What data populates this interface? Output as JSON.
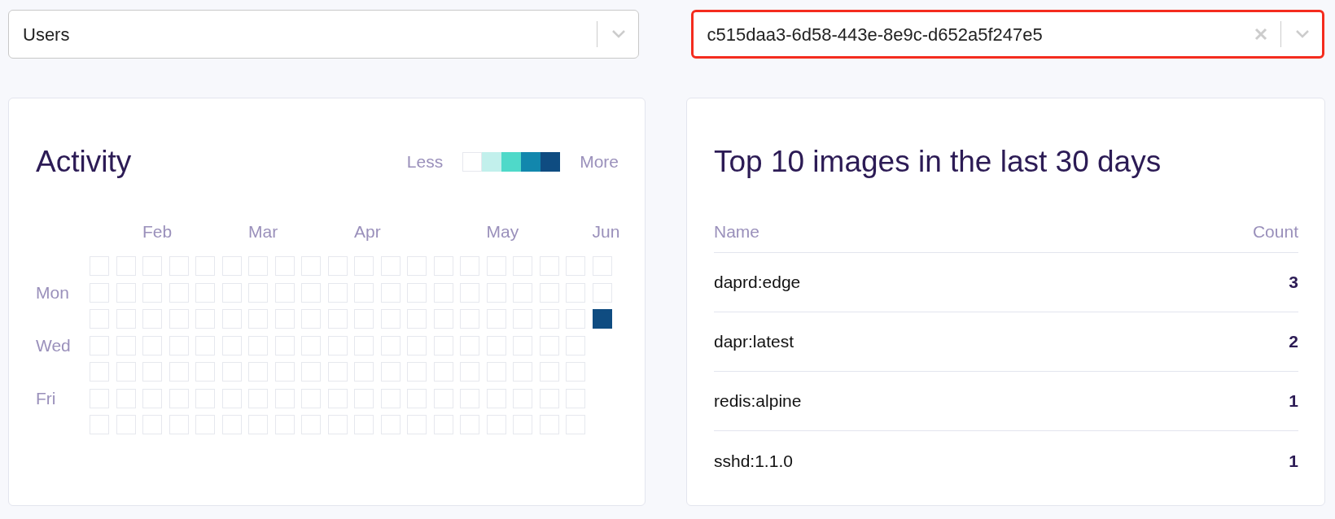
{
  "selects": [
    {
      "value": "Users",
      "clearable": false,
      "focused": false
    },
    {
      "value": "c515daa3-6d58-443e-8e9c-d652a5f247e5",
      "clearable": true,
      "focused": true
    }
  ],
  "activity": {
    "title": "Activity",
    "legend": {
      "less": "Less",
      "more": "More",
      "swatches": [
        {
          "color": "#ffffff"
        },
        {
          "color": "#c2f0ec"
        },
        {
          "color": "#4fd9c9"
        },
        {
          "color": "#1287ad"
        },
        {
          "color": "#0f4c81"
        }
      ]
    },
    "day_labels": [
      "Mon",
      "Wed",
      "Fri"
    ],
    "weeks": [
      {
        "days": [
          {
            "color": "#ffffff"
          },
          {
            "color": "#ffffff"
          },
          {
            "color": "#ffffff"
          },
          {
            "color": "#ffffff"
          },
          {
            "color": "#ffffff"
          },
          {
            "color": "#ffffff"
          },
          {
            "color": "#ffffff"
          }
        ]
      },
      {
        "days": [
          {
            "color": "#ffffff"
          },
          {
            "color": "#ffffff"
          },
          {
            "color": "#ffffff"
          },
          {
            "color": "#ffffff"
          },
          {
            "color": "#ffffff"
          },
          {
            "color": "#ffffff"
          },
          {
            "color": "#ffffff"
          }
        ]
      },
      {
        "month": "Feb",
        "days": [
          {
            "color": "#ffffff"
          },
          {
            "color": "#ffffff"
          },
          {
            "color": "#ffffff"
          },
          {
            "color": "#ffffff"
          },
          {
            "color": "#ffffff"
          },
          {
            "color": "#ffffff"
          },
          {
            "color": "#ffffff"
          }
        ]
      },
      {
        "days": [
          {
            "color": "#ffffff"
          },
          {
            "color": "#ffffff"
          },
          {
            "color": "#ffffff"
          },
          {
            "color": "#ffffff"
          },
          {
            "color": "#ffffff"
          },
          {
            "color": "#ffffff"
          },
          {
            "color": "#ffffff"
          }
        ]
      },
      {
        "days": [
          {
            "color": "#ffffff"
          },
          {
            "color": "#ffffff"
          },
          {
            "color": "#ffffff"
          },
          {
            "color": "#ffffff"
          },
          {
            "color": "#ffffff"
          },
          {
            "color": "#ffffff"
          },
          {
            "color": "#ffffff"
          }
        ]
      },
      {
        "days": [
          {
            "color": "#ffffff"
          },
          {
            "color": "#ffffff"
          },
          {
            "color": "#ffffff"
          },
          {
            "color": "#ffffff"
          },
          {
            "color": "#ffffff"
          },
          {
            "color": "#ffffff"
          },
          {
            "color": "#ffffff"
          }
        ]
      },
      {
        "month": "Mar",
        "days": [
          {
            "color": "#ffffff"
          },
          {
            "color": "#ffffff"
          },
          {
            "color": "#ffffff"
          },
          {
            "color": "#ffffff"
          },
          {
            "color": "#ffffff"
          },
          {
            "color": "#ffffff"
          },
          {
            "color": "#ffffff"
          }
        ]
      },
      {
        "days": [
          {
            "color": "#ffffff"
          },
          {
            "color": "#ffffff"
          },
          {
            "color": "#ffffff"
          },
          {
            "color": "#ffffff"
          },
          {
            "color": "#ffffff"
          },
          {
            "color": "#ffffff"
          },
          {
            "color": "#ffffff"
          }
        ]
      },
      {
        "days": [
          {
            "color": "#ffffff"
          },
          {
            "color": "#ffffff"
          },
          {
            "color": "#ffffff"
          },
          {
            "color": "#ffffff"
          },
          {
            "color": "#ffffff"
          },
          {
            "color": "#ffffff"
          },
          {
            "color": "#ffffff"
          }
        ]
      },
      {
        "days": [
          {
            "color": "#ffffff"
          },
          {
            "color": "#ffffff"
          },
          {
            "color": "#ffffff"
          },
          {
            "color": "#ffffff"
          },
          {
            "color": "#ffffff"
          },
          {
            "color": "#ffffff"
          },
          {
            "color": "#ffffff"
          }
        ]
      },
      {
        "month": "Apr",
        "days": [
          {
            "color": "#ffffff"
          },
          {
            "color": "#ffffff"
          },
          {
            "color": "#ffffff"
          },
          {
            "color": "#ffffff"
          },
          {
            "color": "#ffffff"
          },
          {
            "color": "#ffffff"
          },
          {
            "color": "#ffffff"
          }
        ]
      },
      {
        "days": [
          {
            "color": "#ffffff"
          },
          {
            "color": "#ffffff"
          },
          {
            "color": "#ffffff"
          },
          {
            "color": "#ffffff"
          },
          {
            "color": "#ffffff"
          },
          {
            "color": "#ffffff"
          },
          {
            "color": "#ffffff"
          }
        ]
      },
      {
        "days": [
          {
            "color": "#ffffff"
          },
          {
            "color": "#ffffff"
          },
          {
            "color": "#ffffff"
          },
          {
            "color": "#ffffff"
          },
          {
            "color": "#ffffff"
          },
          {
            "color": "#ffffff"
          },
          {
            "color": "#ffffff"
          }
        ]
      },
      {
        "days": [
          {
            "color": "#ffffff"
          },
          {
            "color": "#ffffff"
          },
          {
            "color": "#ffffff"
          },
          {
            "color": "#ffffff"
          },
          {
            "color": "#ffffff"
          },
          {
            "color": "#ffffff"
          },
          {
            "color": "#ffffff"
          }
        ]
      },
      {
        "days": [
          {
            "color": "#ffffff"
          },
          {
            "color": "#ffffff"
          },
          {
            "color": "#ffffff"
          },
          {
            "color": "#ffffff"
          },
          {
            "color": "#ffffff"
          },
          {
            "color": "#ffffff"
          },
          {
            "color": "#ffffff"
          }
        ]
      },
      {
        "month": "May",
        "days": [
          {
            "color": "#ffffff"
          },
          {
            "color": "#ffffff"
          },
          {
            "color": "#ffffff"
          },
          {
            "color": "#ffffff"
          },
          {
            "color": "#ffffff"
          },
          {
            "color": "#ffffff"
          },
          {
            "color": "#ffffff"
          }
        ]
      },
      {
        "days": [
          {
            "color": "#ffffff"
          },
          {
            "color": "#ffffff"
          },
          {
            "color": "#ffffff"
          },
          {
            "color": "#ffffff"
          },
          {
            "color": "#ffffff"
          },
          {
            "color": "#ffffff"
          },
          {
            "color": "#ffffff"
          }
        ]
      },
      {
        "days": [
          {
            "color": "#ffffff"
          },
          {
            "color": "#ffffff"
          },
          {
            "color": "#ffffff"
          },
          {
            "color": "#ffffff"
          },
          {
            "color": "#ffffff"
          },
          {
            "color": "#ffffff"
          },
          {
            "color": "#ffffff"
          }
        ]
      },
      {
        "days": [
          {
            "color": "#ffffff"
          },
          {
            "color": "#ffffff"
          },
          {
            "color": "#ffffff"
          },
          {
            "color": "#ffffff"
          },
          {
            "color": "#ffffff"
          },
          {
            "color": "#ffffff"
          },
          {
            "color": "#ffffff"
          }
        ]
      },
      {
        "month": "Jun",
        "days": [
          {
            "color": "#ffffff"
          },
          {
            "color": "#ffffff"
          },
          {
            "color": "#0f4c81"
          }
        ]
      }
    ]
  },
  "top_images": {
    "title": "Top 10 images in the last 30 days",
    "columns": [
      "Name",
      "Count"
    ],
    "rows": [
      {
        "name": "daprd:edge",
        "count": "3"
      },
      {
        "name": "dapr:latest",
        "count": "2"
      },
      {
        "name": "redis:alpine",
        "count": "1"
      },
      {
        "name": "sshd:1.1.0",
        "count": "1"
      }
    ]
  }
}
